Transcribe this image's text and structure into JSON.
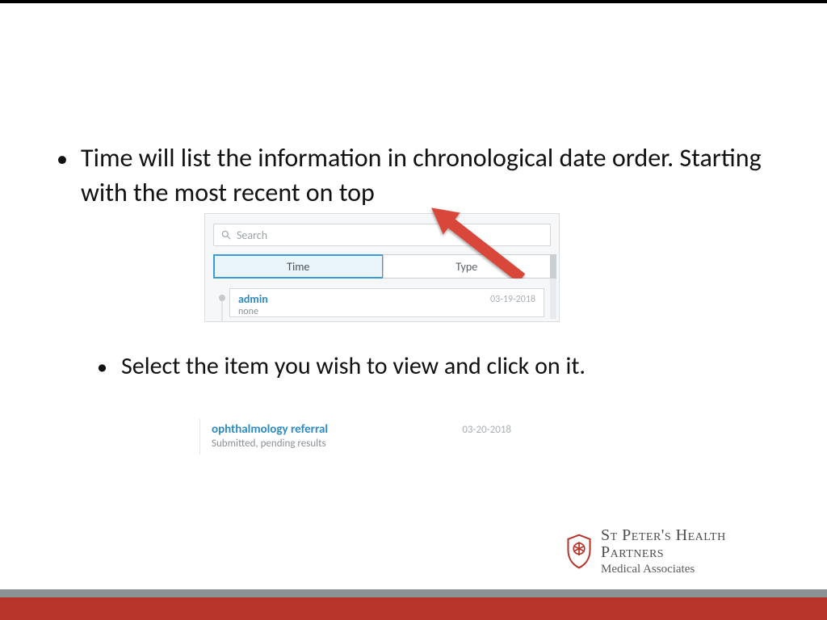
{
  "bullets": {
    "b1": "Time will list the information in chronological date order. Starting with the most recent on top",
    "b2": "Select the item you wish to view and click on it."
  },
  "panel": {
    "search_placeholder": "Search",
    "tabs": {
      "time": "Time",
      "type": "Type"
    },
    "entry": {
      "title": "admin",
      "sub": "none",
      "date": "03-19-2018"
    }
  },
  "item": {
    "title": "ophthalmology referral",
    "sub": "Submitted, pending results",
    "date": "03-20-2018"
  },
  "logo": {
    "line1a": "St Peter's Health",
    "line1b": "Partners",
    "line2": "Medical Associates"
  },
  "colors": {
    "accent_blue": "#2e8bc0",
    "arrow_red": "#d9463a",
    "brand_red": "#b7342a",
    "bar_gray": "#8a9296"
  }
}
